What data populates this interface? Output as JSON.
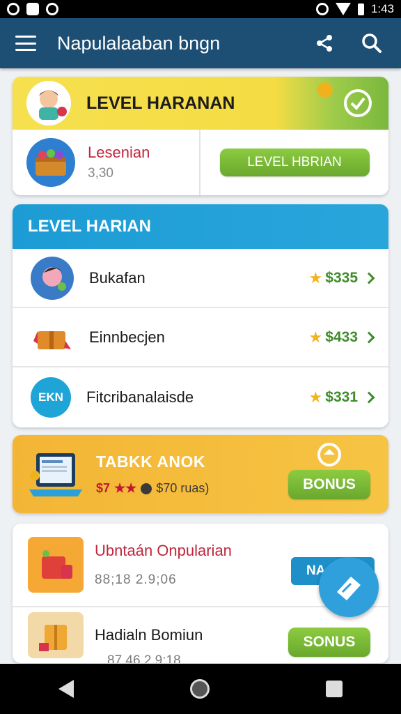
{
  "status_bar": {
    "time": "1:43"
  },
  "app_bar": {
    "title": "Napulalaaban bngn",
    "share_icon": "share-icon",
    "search_icon": "search-icon"
  },
  "card_level": {
    "header_title": "LEVEL HARANAN",
    "item_name": "Lesenian",
    "item_value": "3,30",
    "button_label": "LEVEL HBRIAN"
  },
  "card_list": {
    "header_title": "LEVEL HARIAN",
    "rows": [
      {
        "label": "Bukafan",
        "price": "$335"
      },
      {
        "label": "Einnbecjen",
        "price": "$433"
      },
      {
        "label": "Fitcribanalaisde",
        "price": "$331"
      }
    ],
    "badge_text": "EKN"
  },
  "card_bonus": {
    "title": "TABKK ANOK",
    "price": "$7",
    "stars": "★★",
    "amount": "$70 ruas)",
    "button_label": "BONUS"
  },
  "card_offers": {
    "row1_name": "Ubntaán Onpularian",
    "row1_sub": "88;18  2.9;06",
    "tag_label": "NA",
    "row2_name": "Hadialn Bomiun",
    "row2_sub": "87 46  2.9:18",
    "button_label": "SONUS"
  },
  "colors": {
    "appbar": "#1d4e74",
    "accent_green": "#6aa82e",
    "accent_blue": "#1d9bd4",
    "accent_yellow": "#f4b535",
    "price_green": "#3f8c2a"
  }
}
